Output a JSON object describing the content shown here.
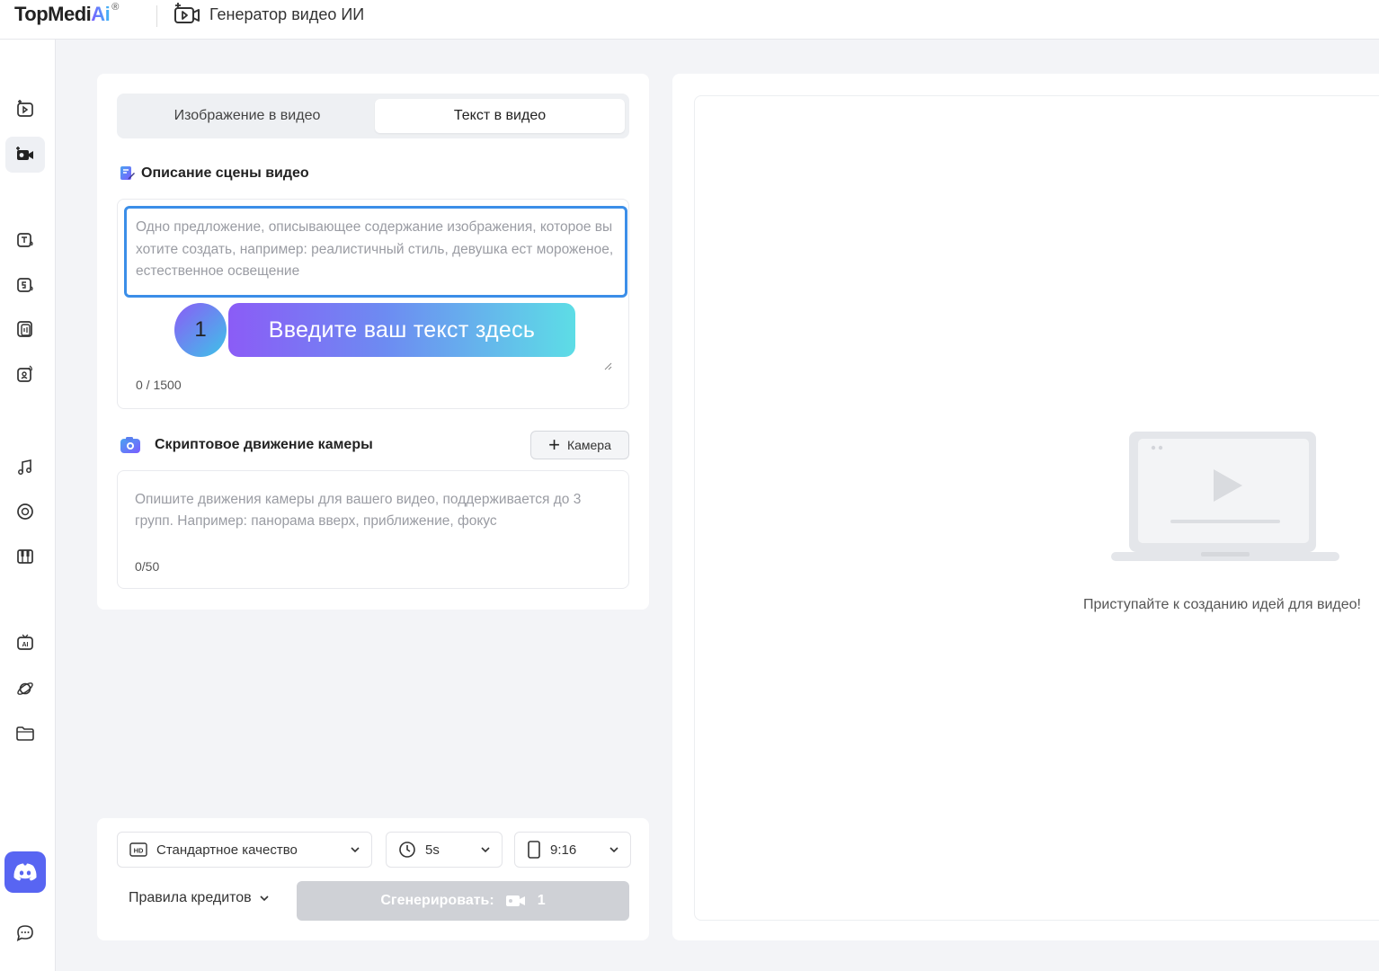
{
  "app": {
    "logo_main": "TopMedi",
    "logo_ai": "Ai",
    "logo_reg": "®",
    "title": "Генератор видео ИИ"
  },
  "sidebar": {
    "items": [
      {
        "icon": "image-to-video-icon",
        "active": false
      },
      {
        "icon": "video-camera-icon",
        "active": true
      },
      {
        "icon": "text-to-speech-icon",
        "active": false
      },
      {
        "icon": "speech-icon",
        "active": false
      },
      {
        "icon": "voice-icon",
        "active": false
      },
      {
        "icon": "voice-clone-icon",
        "active": false
      },
      {
        "icon": "music-icon",
        "active": false
      },
      {
        "icon": "vinyl-icon",
        "active": false
      },
      {
        "icon": "piano-icon",
        "active": false
      },
      {
        "icon": "ai-chat-icon",
        "active": false
      },
      {
        "icon": "planet-icon",
        "active": false
      },
      {
        "icon": "folder-icon",
        "active": false
      }
    ],
    "discord_icon": "discord-icon",
    "feedback_icon": "chat-bubble-icon"
  },
  "tabs": [
    {
      "label": "Изображение в видео",
      "active": false
    },
    {
      "label": "Текст в видео",
      "active": true
    }
  ],
  "scene": {
    "title": "Описание сцены видео",
    "placeholder": "Одно предложение, описывающее содержание изображения, которое вы хотите создать, например: реалистичный стиль, девушка ест мороженое, естественное освещение",
    "counter": "0 / 1500"
  },
  "tip": {
    "step": "1",
    "text": "Введите ваш текст здесь"
  },
  "camera": {
    "title": "Скриптовое движение камеры",
    "button_label": "Камера",
    "placeholder": "Опишите движения камеры для вашего видео, поддерживается до 3 групп. Например: панорама вверх, приближение, фокус",
    "counter": "0/50"
  },
  "bottom": {
    "quality": "Стандартное качество",
    "duration": "5s",
    "ratio": "9:16",
    "credits_label": "Правила кредитов",
    "generate_label": "Сгенерировать:",
    "generate_cost": "1"
  },
  "preview": {
    "empty_text": "Приступайте к созданию идей для видео!"
  },
  "colors": {
    "accent_blue": "#3b8ee8",
    "gradient_start": "#8b5cf6",
    "gradient_end": "#5ddde6",
    "disabled_button": "#cfd1d6",
    "discord": "#5865f2"
  }
}
